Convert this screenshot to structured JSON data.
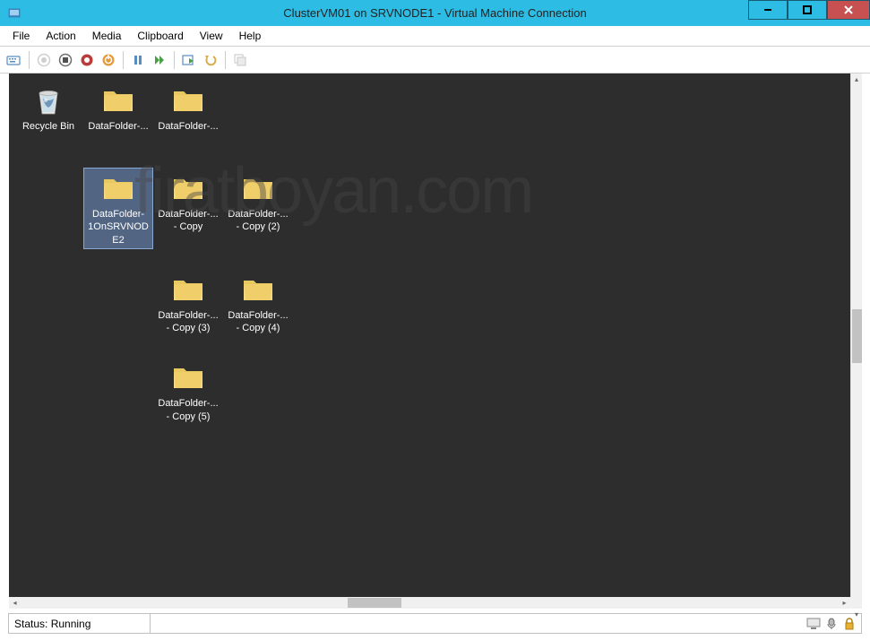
{
  "window": {
    "title": "ClusterVM01 on SRVNODE1 - Virtual Machine Connection"
  },
  "menu": {
    "items": [
      "File",
      "Action",
      "Media",
      "Clipboard",
      "View",
      "Help"
    ]
  },
  "toolbar": {
    "buttons": [
      {
        "name": "ctrl-alt-del",
        "disabled": false
      },
      {
        "name": "start",
        "disabled": true
      },
      {
        "name": "stop",
        "disabled": false
      },
      {
        "name": "shutdown",
        "disabled": false
      },
      {
        "name": "save",
        "disabled": false
      },
      {
        "name": "pause",
        "disabled": false
      },
      {
        "name": "reset",
        "disabled": false
      },
      {
        "name": "checkpoint",
        "disabled": false
      },
      {
        "name": "revert",
        "disabled": false
      },
      {
        "name": "share",
        "disabled": true
      }
    ]
  },
  "desktop": {
    "rows": [
      [
        {
          "name": "recycle-bin",
          "label": "Recycle Bin",
          "type": "recycle",
          "selected": false
        },
        {
          "name": "folder-1",
          "label": "DataFolder-...",
          "type": "folder",
          "selected": false
        },
        {
          "name": "folder-2",
          "label": "DataFolder-...",
          "type": "folder",
          "selected": false
        }
      ],
      [
        {
          "name": "spacer",
          "type": "spacer"
        },
        {
          "name": "folder-3",
          "label": "DataFolder-1OnSRVNODE2",
          "type": "folder",
          "selected": true
        },
        {
          "name": "folder-4",
          "label": "DataFolder-... - Copy",
          "type": "folder",
          "selected": false
        },
        {
          "name": "folder-5",
          "label": "DataFolder-... - Copy (2)",
          "type": "folder",
          "selected": false
        }
      ],
      [
        {
          "name": "spacer",
          "type": "spacer"
        },
        {
          "name": "spacer",
          "type": "spacer"
        },
        {
          "name": "folder-6",
          "label": "DataFolder-... - Copy (3)",
          "type": "folder",
          "selected": false
        },
        {
          "name": "folder-7",
          "label": "DataFolder-... - Copy (4)",
          "type": "folder",
          "selected": false
        }
      ],
      [
        {
          "name": "spacer",
          "type": "spacer"
        },
        {
          "name": "spacer",
          "type": "spacer"
        },
        {
          "name": "folder-8",
          "label": "DataFolder-... - Copy (5)",
          "type": "folder",
          "selected": false
        }
      ]
    ]
  },
  "status": {
    "text": "Status: Running"
  },
  "watermark": "firatboyan.com"
}
